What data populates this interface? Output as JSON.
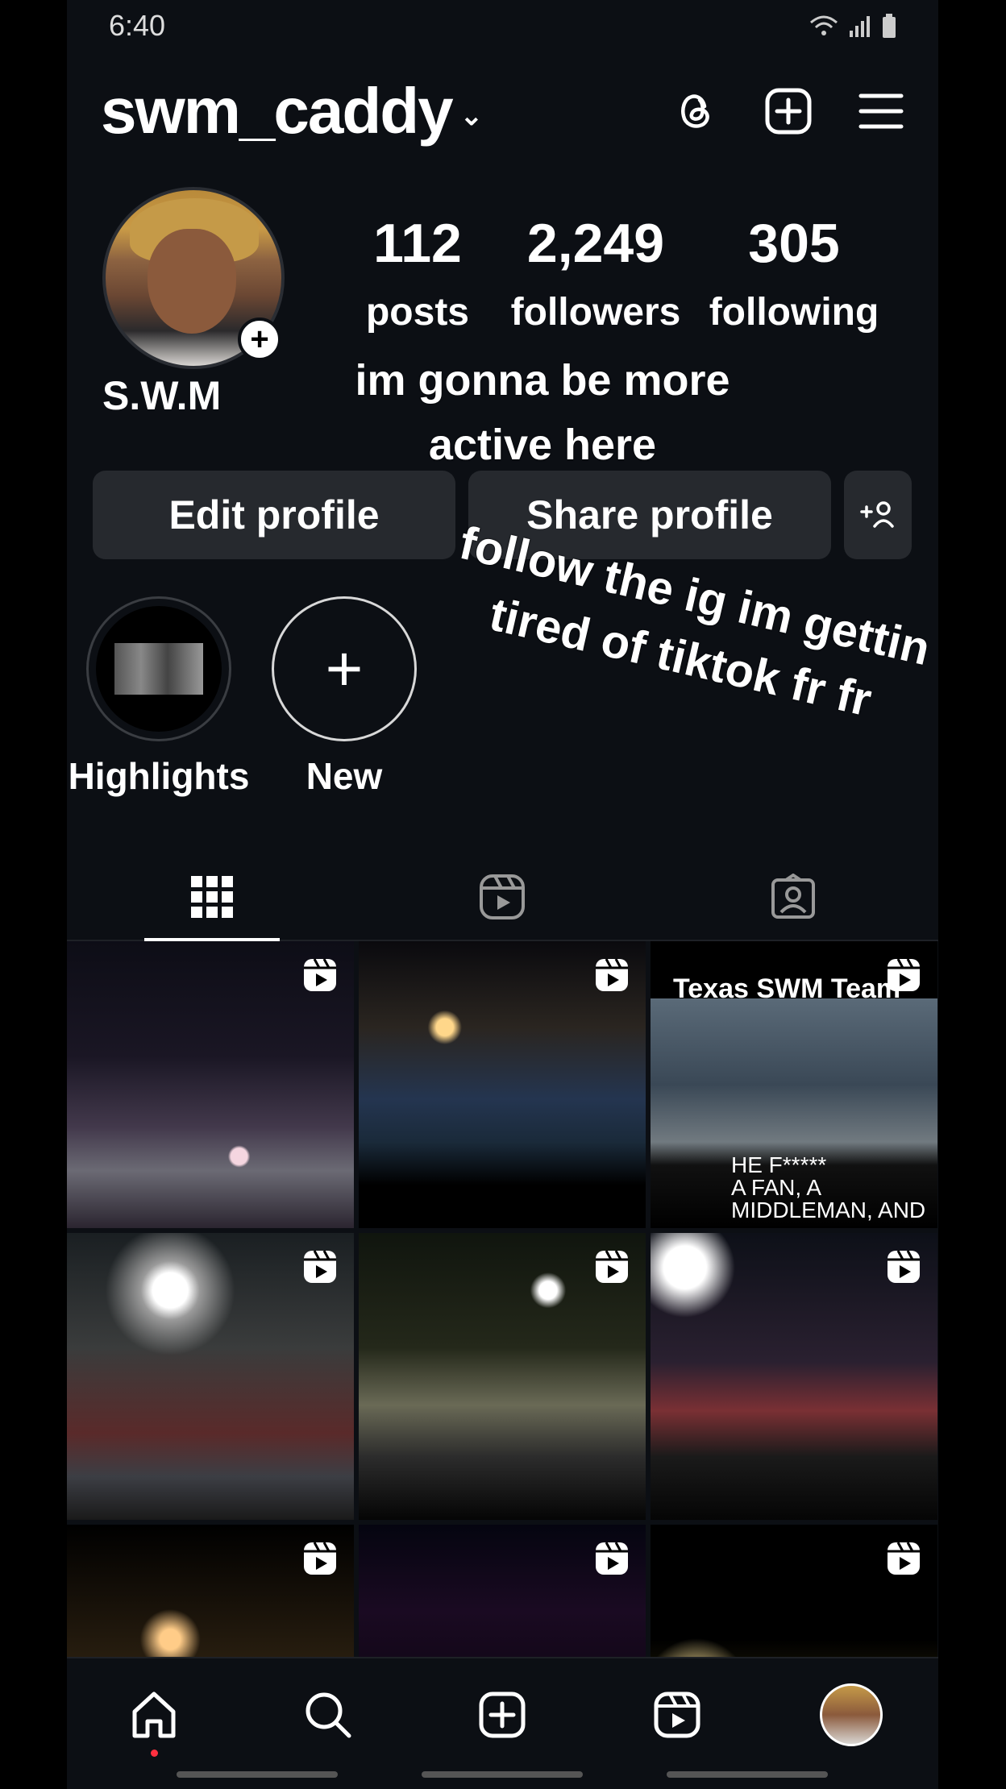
{
  "status_bar": {
    "time": "6:40"
  },
  "header": {
    "username": "swm_caddy",
    "username_chevron": "⌄"
  },
  "profile": {
    "display_name": "S.W.M",
    "avatar_add": "+",
    "stats": [
      {
        "value": "112",
        "label": "posts"
      },
      {
        "value": "2,249",
        "label": "followers"
      },
      {
        "value": "305",
        "label": "following"
      }
    ]
  },
  "overlay_text": {
    "line1": "im gonna be more active here",
    "line2": "follow the ig im gettin tired of tiktok fr fr"
  },
  "buttons": {
    "edit": "Edit profile",
    "share": "Share profile"
  },
  "highlights": [
    {
      "label": "Highlights"
    },
    {
      "label": "New",
      "symbol": "+"
    }
  ],
  "grid": {
    "captions": {
      "cell3_top": "Texas SWM Team",
      "cell3_bottom_1": "HE F*****",
      "cell3_bottom_2": "A FAN, A",
      "cell3_bottom_3": "MIDDLEMAN, AND"
    }
  }
}
